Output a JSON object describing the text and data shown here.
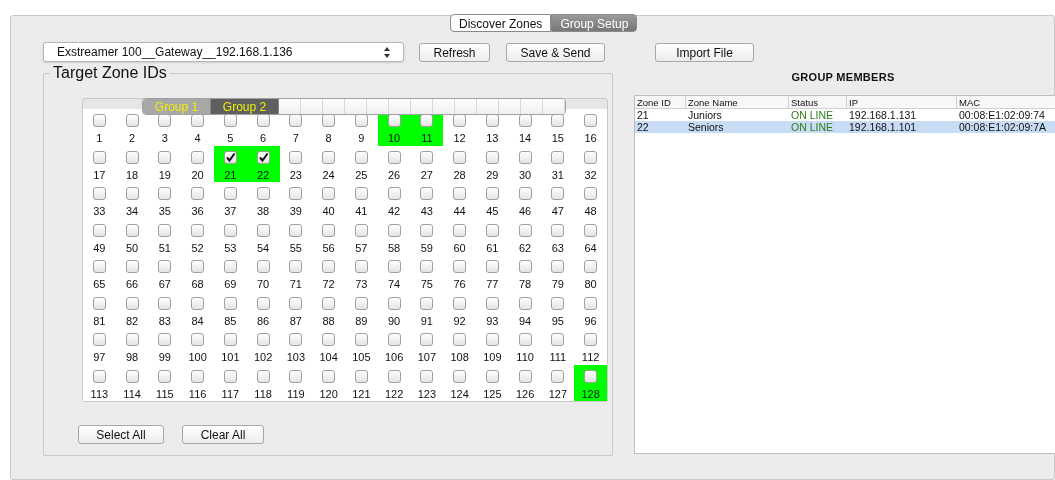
{
  "view_tabs": [
    {
      "label": "Discover Zones",
      "selected": false
    },
    {
      "label": "Group Setup",
      "selected": true
    }
  ],
  "gateway_select": {
    "value": "Exstreamer 100__Gateway__192.168.1.136"
  },
  "toolbar_buttons": [
    "Refresh",
    "Save & Send",
    "Import File"
  ],
  "target_zones": {
    "title": "Target Zone IDs",
    "group_tabs": [
      {
        "label": "Group 1",
        "selected": false
      },
      {
        "label": "Group 2",
        "selected": true
      }
    ],
    "zones": [
      {
        "label": "1",
        "checked": false,
        "assigned": false
      },
      {
        "label": "2",
        "checked": false,
        "assigned": false
      },
      {
        "label": "3",
        "checked": false,
        "assigned": false
      },
      {
        "label": "4",
        "checked": false,
        "assigned": false
      },
      {
        "label": "5",
        "checked": false,
        "assigned": false
      },
      {
        "label": "6",
        "checked": false,
        "assigned": false
      },
      {
        "label": "7",
        "checked": false,
        "assigned": false
      },
      {
        "label": "8",
        "checked": false,
        "assigned": false
      },
      {
        "label": "9",
        "checked": false,
        "assigned": false
      },
      {
        "label": "10",
        "checked": false,
        "assigned": true
      },
      {
        "label": "11",
        "checked": false,
        "assigned": true
      },
      {
        "label": "12",
        "checked": false,
        "assigned": false
      },
      {
        "label": "13",
        "checked": false,
        "assigned": false
      },
      {
        "label": "14",
        "checked": false,
        "assigned": false
      },
      {
        "label": "15",
        "checked": false,
        "assigned": false
      },
      {
        "label": "16",
        "checked": false,
        "assigned": false
      },
      {
        "label": "17",
        "checked": false,
        "assigned": false
      },
      {
        "label": "18",
        "checked": false,
        "assigned": false
      },
      {
        "label": "19",
        "checked": false,
        "assigned": false
      },
      {
        "label": "20",
        "checked": false,
        "assigned": false
      },
      {
        "label": "21",
        "checked": true,
        "assigned": true
      },
      {
        "label": "22",
        "checked": true,
        "assigned": true
      },
      {
        "label": "23",
        "checked": false,
        "assigned": false
      },
      {
        "label": "24",
        "checked": false,
        "assigned": false
      },
      {
        "label": "25",
        "checked": false,
        "assigned": false
      },
      {
        "label": "26",
        "checked": false,
        "assigned": false
      },
      {
        "label": "27",
        "checked": false,
        "assigned": false
      },
      {
        "label": "28",
        "checked": false,
        "assigned": false
      },
      {
        "label": "29",
        "checked": false,
        "assigned": false
      },
      {
        "label": "30",
        "checked": false,
        "assigned": false
      },
      {
        "label": "31",
        "checked": false,
        "assigned": false
      },
      {
        "label": "32",
        "checked": false,
        "assigned": false
      },
      {
        "label": "33",
        "checked": false,
        "assigned": false
      },
      {
        "label": "34",
        "checked": false,
        "assigned": false
      },
      {
        "label": "35",
        "checked": false,
        "assigned": false
      },
      {
        "label": "36",
        "checked": false,
        "assigned": false
      },
      {
        "label": "37",
        "checked": false,
        "assigned": false
      },
      {
        "label": "38",
        "checked": false,
        "assigned": false
      },
      {
        "label": "39",
        "checked": false,
        "assigned": false
      },
      {
        "label": "40",
        "checked": false,
        "assigned": false
      },
      {
        "label": "41",
        "checked": false,
        "assigned": false
      },
      {
        "label": "42",
        "checked": false,
        "assigned": false
      },
      {
        "label": "43",
        "checked": false,
        "assigned": false
      },
      {
        "label": "44",
        "checked": false,
        "assigned": false
      },
      {
        "label": "45",
        "checked": false,
        "assigned": false
      },
      {
        "label": "46",
        "checked": false,
        "assigned": false
      },
      {
        "label": "47",
        "checked": false,
        "assigned": false
      },
      {
        "label": "48",
        "checked": false,
        "assigned": false
      },
      {
        "label": "49",
        "checked": false,
        "assigned": false
      },
      {
        "label": "50",
        "checked": false,
        "assigned": false
      },
      {
        "label": "51",
        "checked": false,
        "assigned": false
      },
      {
        "label": "52",
        "checked": false,
        "assigned": false
      },
      {
        "label": "53",
        "checked": false,
        "assigned": false
      },
      {
        "label": "54",
        "checked": false,
        "assigned": false
      },
      {
        "label": "55",
        "checked": false,
        "assigned": false
      },
      {
        "label": "56",
        "checked": false,
        "assigned": false
      },
      {
        "label": "57",
        "checked": false,
        "assigned": false
      },
      {
        "label": "58",
        "checked": false,
        "assigned": false
      },
      {
        "label": "59",
        "checked": false,
        "assigned": false
      },
      {
        "label": "60",
        "checked": false,
        "assigned": false
      },
      {
        "label": "61",
        "checked": false,
        "assigned": false
      },
      {
        "label": "62",
        "checked": false,
        "assigned": false
      },
      {
        "label": "63",
        "checked": false,
        "assigned": false
      },
      {
        "label": "64",
        "checked": false,
        "assigned": false
      },
      {
        "label": "65",
        "checked": false,
        "assigned": false
      },
      {
        "label": "66",
        "checked": false,
        "assigned": false
      },
      {
        "label": "67",
        "checked": false,
        "assigned": false
      },
      {
        "label": "68",
        "checked": false,
        "assigned": false
      },
      {
        "label": "69",
        "checked": false,
        "assigned": false
      },
      {
        "label": "70",
        "checked": false,
        "assigned": false
      },
      {
        "label": "71",
        "checked": false,
        "assigned": false
      },
      {
        "label": "72",
        "checked": false,
        "assigned": false
      },
      {
        "label": "73",
        "checked": false,
        "assigned": false
      },
      {
        "label": "74",
        "checked": false,
        "assigned": false
      },
      {
        "label": "75",
        "checked": false,
        "assigned": false
      },
      {
        "label": "76",
        "checked": false,
        "assigned": false
      },
      {
        "label": "77",
        "checked": false,
        "assigned": false
      },
      {
        "label": "78",
        "checked": false,
        "assigned": false
      },
      {
        "label": "79",
        "checked": false,
        "assigned": false
      },
      {
        "label": "80",
        "checked": false,
        "assigned": false
      },
      {
        "label": "81",
        "checked": false,
        "assigned": false
      },
      {
        "label": "82",
        "checked": false,
        "assigned": false
      },
      {
        "label": "83",
        "checked": false,
        "assigned": false
      },
      {
        "label": "84",
        "checked": false,
        "assigned": false
      },
      {
        "label": "85",
        "checked": false,
        "assigned": false
      },
      {
        "label": "86",
        "checked": false,
        "assigned": false
      },
      {
        "label": "87",
        "checked": false,
        "assigned": false
      },
      {
        "label": "88",
        "checked": false,
        "assigned": false
      },
      {
        "label": "89",
        "checked": false,
        "assigned": false
      },
      {
        "label": "90",
        "checked": false,
        "assigned": false
      },
      {
        "label": "91",
        "checked": false,
        "assigned": false
      },
      {
        "label": "92",
        "checked": false,
        "assigned": false
      },
      {
        "label": "93",
        "checked": false,
        "assigned": false
      },
      {
        "label": "94",
        "checked": false,
        "assigned": false
      },
      {
        "label": "95",
        "checked": false,
        "assigned": false
      },
      {
        "label": "96",
        "checked": false,
        "assigned": false
      },
      {
        "label": "97",
        "checked": false,
        "assigned": false
      },
      {
        "label": "98",
        "checked": false,
        "assigned": false
      },
      {
        "label": "99",
        "checked": false,
        "assigned": false
      },
      {
        "label": "100",
        "checked": false,
        "assigned": false
      },
      {
        "label": "101",
        "checked": false,
        "assigned": false
      },
      {
        "label": "102",
        "checked": false,
        "assigned": false
      },
      {
        "label": "103",
        "checked": false,
        "assigned": false
      },
      {
        "label": "104",
        "checked": false,
        "assigned": false
      },
      {
        "label": "105",
        "checked": false,
        "assigned": false
      },
      {
        "label": "106",
        "checked": false,
        "assigned": false
      },
      {
        "label": "107",
        "checked": false,
        "assigned": false
      },
      {
        "label": "108",
        "checked": false,
        "assigned": false
      },
      {
        "label": "109",
        "checked": false,
        "assigned": false
      },
      {
        "label": "110",
        "checked": false,
        "assigned": false
      },
      {
        "label": "111",
        "checked": false,
        "assigned": false
      },
      {
        "label": "112",
        "checked": false,
        "assigned": false
      },
      {
        "label": "113",
        "checked": false,
        "assigned": false
      },
      {
        "label": "114",
        "checked": false,
        "assigned": false
      },
      {
        "label": "115",
        "checked": false,
        "assigned": false
      },
      {
        "label": "116",
        "checked": false,
        "assigned": false
      },
      {
        "label": "117",
        "checked": false,
        "assigned": false
      },
      {
        "label": "118",
        "checked": false,
        "assigned": false
      },
      {
        "label": "119",
        "checked": false,
        "assigned": false
      },
      {
        "label": "120",
        "checked": false,
        "assigned": false
      },
      {
        "label": "121",
        "checked": false,
        "assigned": false
      },
      {
        "label": "122",
        "checked": false,
        "assigned": false
      },
      {
        "label": "123",
        "checked": false,
        "assigned": false
      },
      {
        "label": "124",
        "checked": false,
        "assigned": false
      },
      {
        "label": "125",
        "checked": false,
        "assigned": false
      },
      {
        "label": "126",
        "checked": false,
        "assigned": false
      },
      {
        "label": "127",
        "checked": false,
        "assigned": false
      },
      {
        "label": "128",
        "checked": false,
        "assigned": true
      }
    ],
    "buttons": [
      "Select All",
      "Clear All"
    ]
  },
  "group_members": {
    "title": "GROUP MEMBERS",
    "columns": [
      "Zone ID",
      "Zone Name",
      "Status",
      "IP",
      "MAC"
    ],
    "rows": [
      {
        "cells": [
          "21",
          "Juniors",
          "ON LINE",
          "192.168.1.131",
          "00:08:E1:02:09:74"
        ],
        "selected": false
      },
      {
        "cells": [
          "22",
          "Seniors",
          "ON LINE",
          "192.168.1.101",
          "00:08:E1:02:09:7A"
        ],
        "selected": true
      }
    ]
  }
}
